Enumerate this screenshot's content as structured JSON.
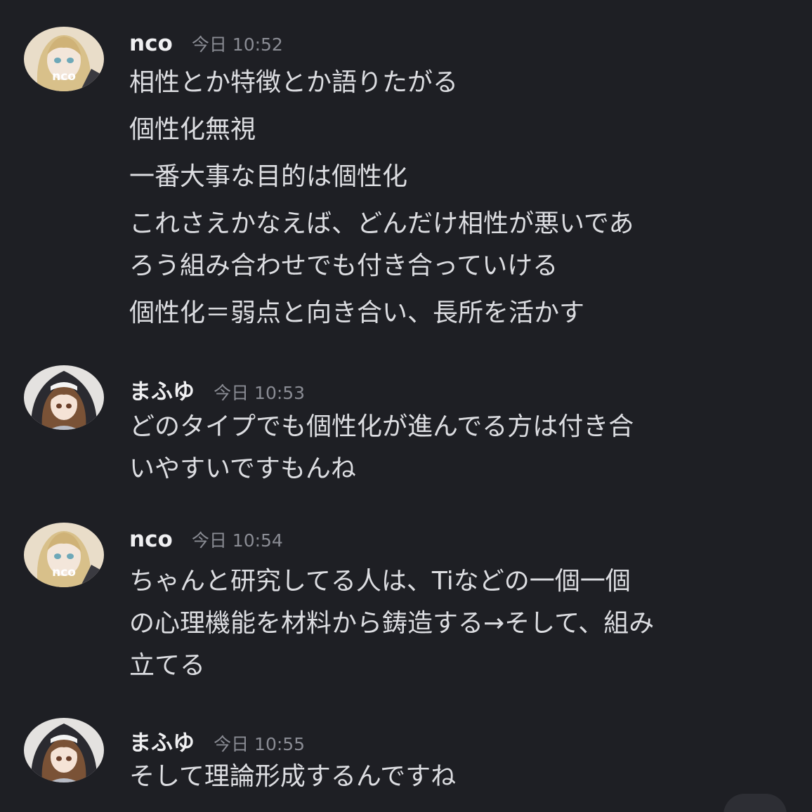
{
  "messages": [
    {
      "author": "nco",
      "time": "今日 10:52",
      "avatar_label": "nco",
      "lines": [
        "相性とか特徴とか語りたがる",
        "個性化無視",
        "一番大事な目的は個性化",
        "これさえかなえば、どんだけ相性が悪いであ",
        "ろう組み合わせでも付き合っていける",
        "個性化＝弱点と向き合い、長所を活かす"
      ]
    },
    {
      "author": "まふゆ",
      "time": "今日 10:53",
      "lines": [
        "どのタイプでも個性化が進んでる方は付き合",
        "いやすいですもんね"
      ]
    },
    {
      "author": "nco",
      "time": "今日 10:54",
      "avatar_label": "nco",
      "lines": [
        "ちゃんと研究してる人は、Tiなどの一個一個",
        "の心理機能を材料から鋳造する→そして、組み",
        "立てる"
      ]
    },
    {
      "author": "まふゆ",
      "time": "今日 10:55",
      "lines": [
        "そして理論形成するんですね"
      ]
    }
  ],
  "icons": {
    "nco_avatar": "avatar-blonde-icon",
    "mafuyu_avatar": "avatar-nun-icon"
  },
  "colors": {
    "background": "#1e1f24",
    "text": "#dcdde1",
    "name": "#f0f0f2",
    "timestamp": "#8a8c94"
  }
}
